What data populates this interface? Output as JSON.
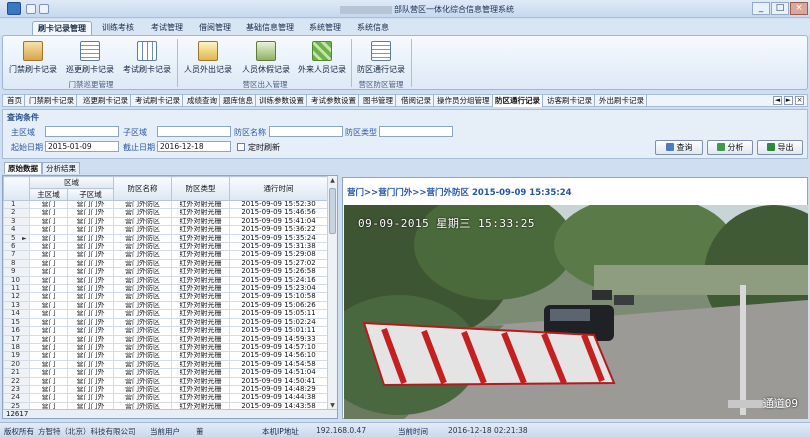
{
  "window": {
    "title": "部队营区一体化综合信息管理系统",
    "controls": [
      "_",
      "□",
      "×"
    ]
  },
  "ribbon_tabs": [
    "刷卡记录管理",
    "训练考核",
    "考试管理",
    "借阅管理",
    "基础信息管理",
    "系统管理",
    "系统信息"
  ],
  "ribbon": {
    "groups": [
      {
        "label": "门禁巡更管理",
        "buttons": [
          "门禁刷卡记录",
          "巡更刷卡记录",
          "考试刷卡记录"
        ]
      },
      {
        "label": "营区出入管理",
        "buttons": [
          "人员外出记录",
          "人员休假记录",
          "外来人员记录"
        ]
      },
      {
        "label": "营区防区管理",
        "buttons": [
          "防区通行记录"
        ]
      }
    ]
  },
  "doc_tabs": [
    "首页",
    "门禁刷卡记录",
    "巡更刷卡记录",
    "考试刷卡记录",
    "成绩查询",
    "题库信息",
    "训练参数设置",
    "考试参数设置",
    "图书管理",
    "借阅记录",
    "操作员分组管理",
    "防区通行记录",
    "访客刷卡记录",
    "外出刷卡记录"
  ],
  "doc_tab_controls": [
    "◄",
    "►",
    "×"
  ],
  "query": {
    "title": "查询条件",
    "labels": {
      "main_area": "主区域",
      "sub_area": "子区域",
      "zone_name": "防区名称",
      "zone_type": "防区类型",
      "start_date": "起始日期",
      "end_date": "截止日期",
      "auto_refresh": "定时刷新"
    },
    "values": {
      "start_date": "2015-01-09",
      "end_date": "2016-12-18"
    },
    "buttons": {
      "query": "查询",
      "analyze": "分析",
      "export": "导出"
    }
  },
  "sub_tabs": [
    "原始数据",
    "分析结果"
  ],
  "grid": {
    "group_header": "区域",
    "columns": [
      "主区域",
      "子区域",
      "防区名称",
      "防区类型",
      "通行时间"
    ],
    "rows": [
      [
        "营门",
        "营门门外",
        "营门外防区",
        "红外对射光栅",
        "2015-09-09 15:52:30"
      ],
      [
        "营门",
        "营门门外",
        "营门外防区",
        "红外对射光栅",
        "2015-09-09 15:46:56"
      ],
      [
        "营门",
        "营门门外",
        "营门外防区",
        "红外对射光栅",
        "2015-09-09 15:41:04"
      ],
      [
        "营门",
        "营门门外",
        "营门外防区",
        "红外对射光栅",
        "2015-09-09 15:36:22"
      ],
      [
        "营门",
        "营门门外",
        "营门外防区",
        "红外对射光栅",
        "2015-09-09 15:35:24"
      ],
      [
        "营门",
        "营门门外",
        "营门外防区",
        "红外对射光栅",
        "2015-09-09 15:31:38"
      ],
      [
        "营门",
        "营门门外",
        "营门外防区",
        "红外对射光栅",
        "2015-09-09 15:29:08"
      ],
      [
        "营门",
        "营门门外",
        "营门外防区",
        "红外对射光栅",
        "2015-09-09 15:27:02"
      ],
      [
        "营门",
        "营门门外",
        "营门外防区",
        "红外对射光栅",
        "2015-09-09 15:26:58"
      ],
      [
        "营门",
        "营门门外",
        "营门外防区",
        "红外对射光栅",
        "2015-09-09 15:24:16"
      ],
      [
        "营门",
        "营门门外",
        "营门外防区",
        "红外对射光栅",
        "2015-09-09 15:23:04"
      ],
      [
        "营门",
        "营门门外",
        "营门外防区",
        "红外对射光栅",
        "2015-09-09 15:10:58"
      ],
      [
        "营门",
        "营门门外",
        "营门外防区",
        "红外对射光栅",
        "2015-09-09 15:06:26"
      ],
      [
        "营门",
        "营门门外",
        "营门外防区",
        "红外对射光栅",
        "2015-09-09 15:05:11"
      ],
      [
        "营门",
        "营门门外",
        "营门外防区",
        "红外对射光栅",
        "2015-09-09 15:02:24"
      ],
      [
        "营门",
        "营门门外",
        "营门外防区",
        "红外对射光栅",
        "2015-09-09 15:01:11"
      ],
      [
        "营门",
        "营门门外",
        "营门外防区",
        "红外对射光栅",
        "2015-09-09 14:59:33"
      ],
      [
        "营门",
        "营门门外",
        "营门外防区",
        "红外对射光栅",
        "2015-09-09 14:57:10"
      ],
      [
        "营门",
        "营门门外",
        "营门外防区",
        "红外对射光栅",
        "2015-09-09 14:56:10"
      ],
      [
        "营门",
        "营门门外",
        "营门外防区",
        "红外对射光栅",
        "2015-09-09 14:54:58"
      ],
      [
        "营门",
        "营门门外",
        "营门外防区",
        "红外对射光栅",
        "2015-09-09 14:51:04"
      ],
      [
        "营门",
        "营门门外",
        "营门外防区",
        "红外对射光栅",
        "2015-09-09 14:50:41"
      ],
      [
        "营门",
        "营门门外",
        "营门外防区",
        "红外对射光栅",
        "2015-09-09 14:48:29"
      ],
      [
        "营门",
        "营门门外",
        "营门外防区",
        "红外对射光栅",
        "2015-09-09 14:44:38"
      ],
      [
        "营门",
        "营门门外",
        "营门外防区",
        "红外对射光栅",
        "2015-09-09 14:43:58"
      ],
      [
        "营门",
        "营门门外",
        "营门外防区",
        "红外对射光栅",
        "2015-09-09 14:40:58"
      ],
      [
        "营门",
        "营门门外",
        "营门外防区",
        "红外对射光栅",
        "2015-09-09 14:34:10"
      ]
    ],
    "record_count": "12617",
    "current_row_marker": "►",
    "current_row_index": 4
  },
  "photo": {
    "caption": "营门>>营门门外>>营门外防区  2015-09-09  15:35:24",
    "overlay_time": "09-09-2015  星期三  15:33:25",
    "channel": "通道09"
  },
  "status": {
    "copyright_label": "版权所有",
    "company": "方智特（北京）科技有限公司",
    "user_label": "当前用户",
    "user_value": "董",
    "ip_label": "本机IP地址",
    "ip_value": "192.168.0.47",
    "time_label": "当前时间",
    "time_value": "2016-12-18 02:21:38"
  },
  "colors": {
    "accent": "#2b58a5",
    "titlebar": "#c5d8ee",
    "ribbon_bg": "#dde9f6",
    "status_bg": "#c9d9ec"
  }
}
